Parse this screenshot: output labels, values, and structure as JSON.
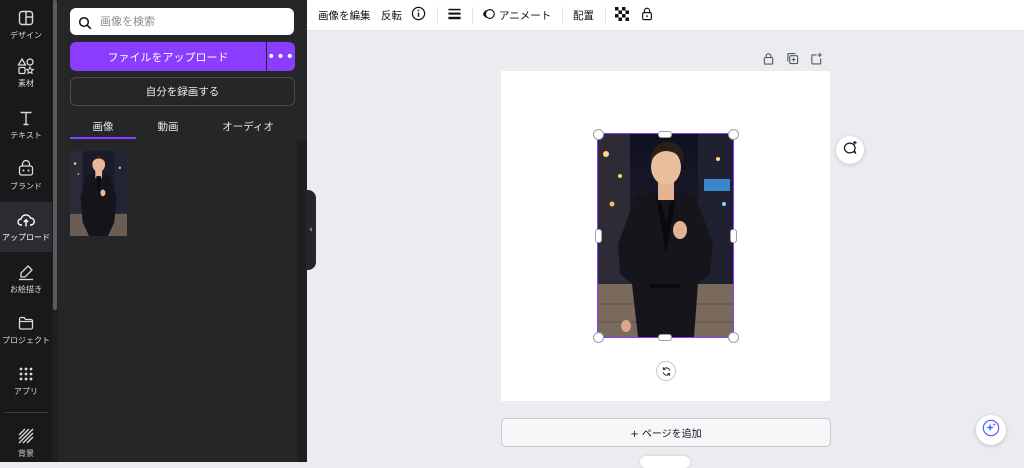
{
  "rail": {
    "items": [
      {
        "label": "デザイン",
        "icon": "layout-icon"
      },
      {
        "label": "素材",
        "icon": "shapes-icon"
      },
      {
        "label": "テキスト",
        "icon": "text-icon"
      },
      {
        "label": "ブランド",
        "icon": "brand-icon"
      },
      {
        "label": "アップロード",
        "icon": "cloud-upload-icon"
      },
      {
        "label": "お絵描き",
        "icon": "draw-icon"
      },
      {
        "label": "プロジェクト",
        "icon": "folder-icon"
      },
      {
        "label": "アプリ",
        "icon": "apps-grid-icon"
      },
      {
        "label": "背景",
        "icon": "background-icon"
      }
    ],
    "active_index": 4
  },
  "panel": {
    "search_placeholder": "画像を検索",
    "upload_label": "ファイルをアップロード",
    "more_label": "•••",
    "record_label": "自分を録画する",
    "tabs": [
      "画像",
      "動画",
      "オーディオ"
    ],
    "active_tab": "画像"
  },
  "toolbar": {
    "edit_image": "画像を編集",
    "flip": "反転",
    "animate": "アニメート",
    "arrange": "配置"
  },
  "canvas": {
    "add_page": "+ ページを追加"
  },
  "colors": {
    "accent": "#8b3dff",
    "rail_bg": "#18191b",
    "panel_bg": "#252627",
    "canvas_bg": "#ebecf0"
  }
}
